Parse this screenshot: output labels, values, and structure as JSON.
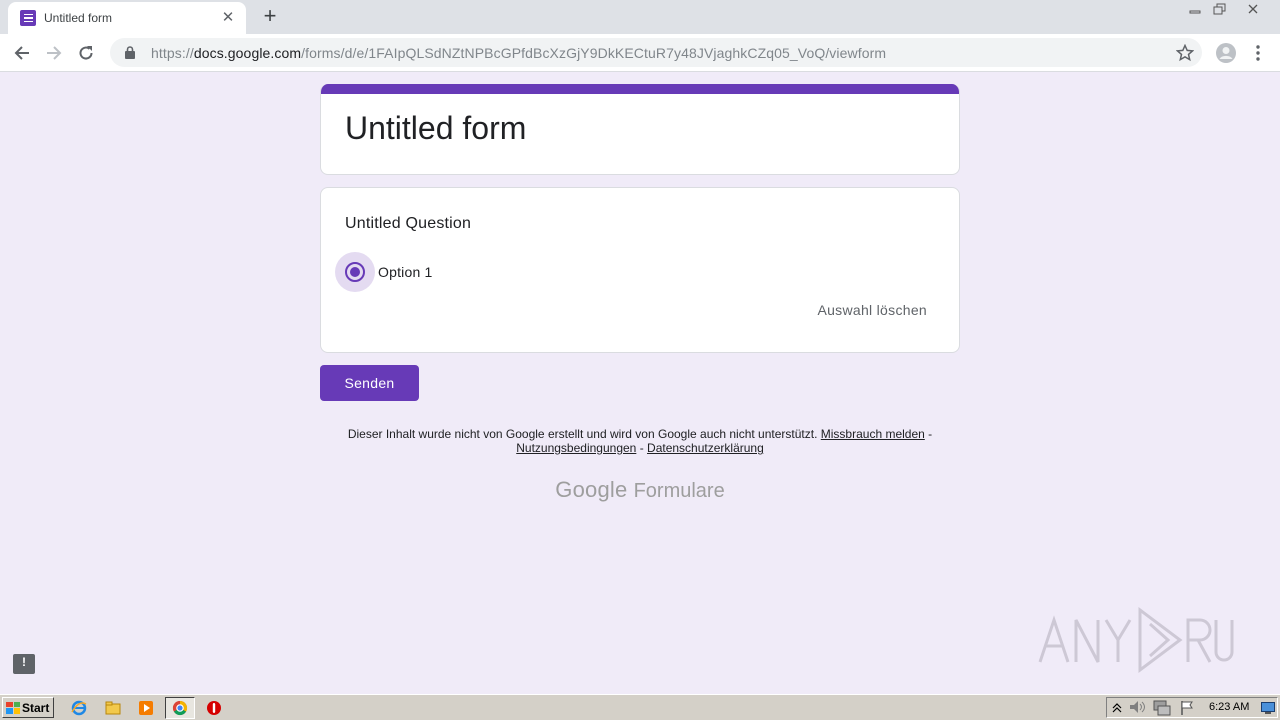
{
  "browser": {
    "tab_title": "Untitled form",
    "url_prefix": "https://",
    "url_domain": "docs.google.com",
    "url_path": "/forms/d/e/1FAIpQLSdNZtNPBcGPfdBcXzGjY9DkKECtuR7y48JVjaghkCZq05_VoQ/viewform"
  },
  "form": {
    "title": "Untitled form",
    "question_title": "Untitled Question",
    "option_label": "Option 1",
    "option_selected": true,
    "clear_selection": "Auswahl löschen",
    "submit_label": "Senden",
    "accent_color": "#673ab7"
  },
  "footer": {
    "disclaimer_text": "Dieser Inhalt wurde nicht von Google erstellt und wird von Google auch nicht unterstützt.",
    "report_abuse": "Missbrauch melden",
    "separator": "-",
    "terms": "Nutzungsbedingungen",
    "privacy": "Datenschutzerklärung",
    "logo_google": "Google",
    "logo_forms": "Formulare"
  },
  "watermark": {
    "text": "ANY RUN"
  },
  "taskbar": {
    "start_label": "Start",
    "clock": "6:23 AM"
  }
}
